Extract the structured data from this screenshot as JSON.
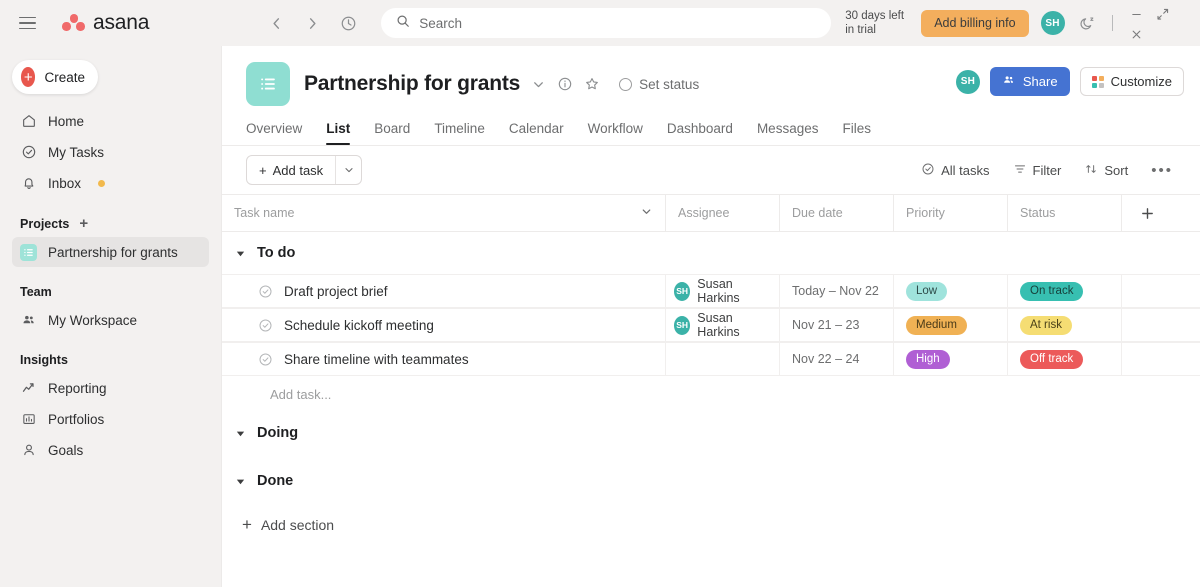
{
  "topbar": {
    "menu_icon": "hamburger-icon",
    "brand_name": "asana",
    "back_icon": "chevron-left-icon",
    "forward_icon": "chevron-right-icon",
    "history_icon": "clock-icon",
    "search": {
      "icon": "search-icon",
      "placeholder": "Search",
      "value": ""
    },
    "trial_line1": "30 days left",
    "trial_line2": "in trial",
    "billing_button": "Add billing info",
    "avatar_initials": "SH",
    "dnd_icon": "moon-zzz-icon",
    "minimize_icon": "minimize-icon",
    "expand_icon": "expand-icon",
    "close_icon": "close-icon"
  },
  "sidebar": {
    "create_label": "Create",
    "nav": [
      {
        "label": "Home",
        "icon": "home-icon"
      },
      {
        "label": "My Tasks",
        "icon": "check-circle-icon"
      },
      {
        "label": "Inbox",
        "icon": "bell-icon",
        "badge": true
      }
    ],
    "projects_header": "Projects",
    "projects_add_icon": "plus-icon",
    "projects": [
      {
        "label": "Partnership for grants",
        "icon": "list-icon",
        "active": true
      }
    ],
    "team_header": "Team",
    "team": [
      {
        "label": "My Workspace",
        "icon": "people-icon"
      }
    ],
    "insights_header": "Insights",
    "insights": [
      {
        "label": "Reporting",
        "icon": "trend-line-icon"
      },
      {
        "label": "Portfolios",
        "icon": "portfolio-chart-icon"
      },
      {
        "label": "Goals",
        "icon": "goal-person-icon"
      }
    ]
  },
  "project": {
    "badge_icon": "project-list-icon",
    "title": "Partnership for grants",
    "caret_icon": "chevron-down-icon",
    "info_icon": "info-circle-icon",
    "star_icon": "star-icon",
    "set_status_label": "Set status",
    "member_avatar": "SH",
    "share_label": "Share",
    "share_icon": "people-icon",
    "customize_label": "Customize",
    "customize_icon": "grid-swatch-icon",
    "tabs": [
      {
        "label": "Overview",
        "active": false
      },
      {
        "label": "List",
        "active": true
      },
      {
        "label": "Board",
        "active": false
      },
      {
        "label": "Timeline",
        "active": false
      },
      {
        "label": "Calendar",
        "active": false
      },
      {
        "label": "Workflow",
        "active": false
      },
      {
        "label": "Dashboard",
        "active": false
      },
      {
        "label": "Messages",
        "active": false
      },
      {
        "label": "Files",
        "active": false
      }
    ]
  },
  "toolbar": {
    "add_task_label": "Add task",
    "add_task_plus": "+",
    "add_task_caret_icon": "chevron-down-icon",
    "all_tasks_label": "All tasks",
    "all_tasks_icon": "check-circle-icon",
    "filter_label": "Filter",
    "filter_icon": "funnel-icon",
    "sort_label": "Sort",
    "sort_icon": "sort-arrows-icon",
    "more_label": "•••"
  },
  "table": {
    "columns": {
      "task": "Task name",
      "assignee": "Assignee",
      "due": "Due date",
      "priority": "Priority",
      "status": "Status",
      "add_icon": "plus-icon"
    },
    "task_sort_caret": "chevron-down-icon",
    "add_task_placeholder": "Add task...",
    "add_section_label": "Add section",
    "sections": [
      {
        "name": "To do",
        "expanded": true,
        "tasks": [
          {
            "name": "Draft project brief",
            "assignee": "Susan Harkins",
            "assignee_initials": "SH",
            "due": "Today – Nov 22",
            "priority": "Low",
            "priority_bg": "#9fe3dc",
            "priority_fg": "#2e4b49",
            "status": "On track",
            "status_bg": "#37bfb1",
            "status_fg": "#17413c"
          },
          {
            "name": "Schedule kickoff meeting",
            "assignee": "Susan Harkins",
            "assignee_initials": "SH",
            "due": "Nov 21 – 23",
            "priority": "Medium",
            "priority_bg": "#f2b košt",
            "priority_fg": "#4a3a18",
            "status": "At risk",
            "status_bg": "#f5dd73",
            "status_fg": "#4a4118"
          },
          {
            "name": "Share timeline with teammates",
            "assignee": "",
            "assignee_initials": "",
            "due": "Nov 22 – 24",
            "priority": "High",
            "priority_bg": "#b05fd4",
            "priority_fg": "#ffffff",
            "status": "Off track",
            "status_bg": "#ec5a5a",
            "status_fg": "#ffffff"
          }
        ]
      },
      {
        "name": "Doing",
        "expanded": true,
        "tasks": []
      },
      {
        "name": "Done",
        "expanded": true,
        "tasks": []
      }
    ]
  },
  "colors": {
    "accent_blue": "#4573d2",
    "brand_red": "#f06a6a",
    "teal": "#3bb2a8",
    "orange": "#f3ae5d",
    "sidebar_bg": "#f3f1f0"
  }
}
